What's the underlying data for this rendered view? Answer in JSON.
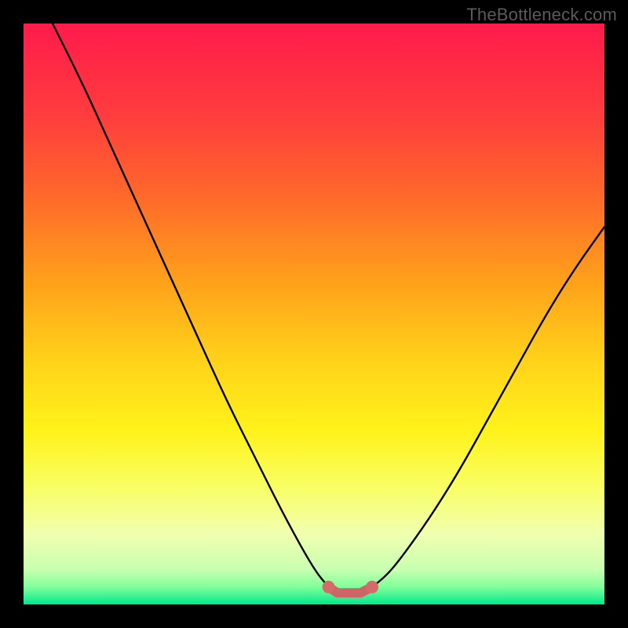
{
  "watermark": "TheBottleneck.com",
  "chart_data": {
    "type": "line",
    "title": "",
    "xlabel": "",
    "ylabel": "",
    "xlim": [
      0,
      100
    ],
    "ylim": [
      0,
      100
    ],
    "series": [
      {
        "name": "left_curve",
        "x": [
          5,
          10,
          15,
          20,
          25,
          30,
          35,
          40,
          45,
          50,
          52.5
        ],
        "values": [
          100,
          90,
          79,
          68,
          57,
          46,
          35,
          25,
          15,
          6,
          3
        ]
      },
      {
        "name": "right_curve",
        "x": [
          60,
          62.5,
          65,
          70,
          75,
          80,
          85,
          90,
          95,
          100
        ],
        "values": [
          3,
          5,
          8,
          15,
          23,
          32,
          41,
          50,
          58,
          65
        ]
      },
      {
        "name": "bottom_marker",
        "x": [
          52.5,
          54,
          56,
          58,
          60
        ],
        "values": [
          3,
          2,
          2,
          2,
          3
        ]
      }
    ],
    "gradient_stops": [
      {
        "offset": 0.0,
        "color": "#ff1b4b"
      },
      {
        "offset": 0.16,
        "color": "#ff3d3d"
      },
      {
        "offset": 0.3,
        "color": "#ff6a2a"
      },
      {
        "offset": 0.45,
        "color": "#ffa31a"
      },
      {
        "offset": 0.58,
        "color": "#ffd21a"
      },
      {
        "offset": 0.7,
        "color": "#fff21a"
      },
      {
        "offset": 0.8,
        "color": "#f8ff66"
      },
      {
        "offset": 0.88,
        "color": "#f0ffb0"
      },
      {
        "offset": 0.94,
        "color": "#c8ffb0"
      },
      {
        "offset": 0.97,
        "color": "#80ff9a"
      },
      {
        "offset": 1.0,
        "color": "#00e88c"
      }
    ]
  }
}
